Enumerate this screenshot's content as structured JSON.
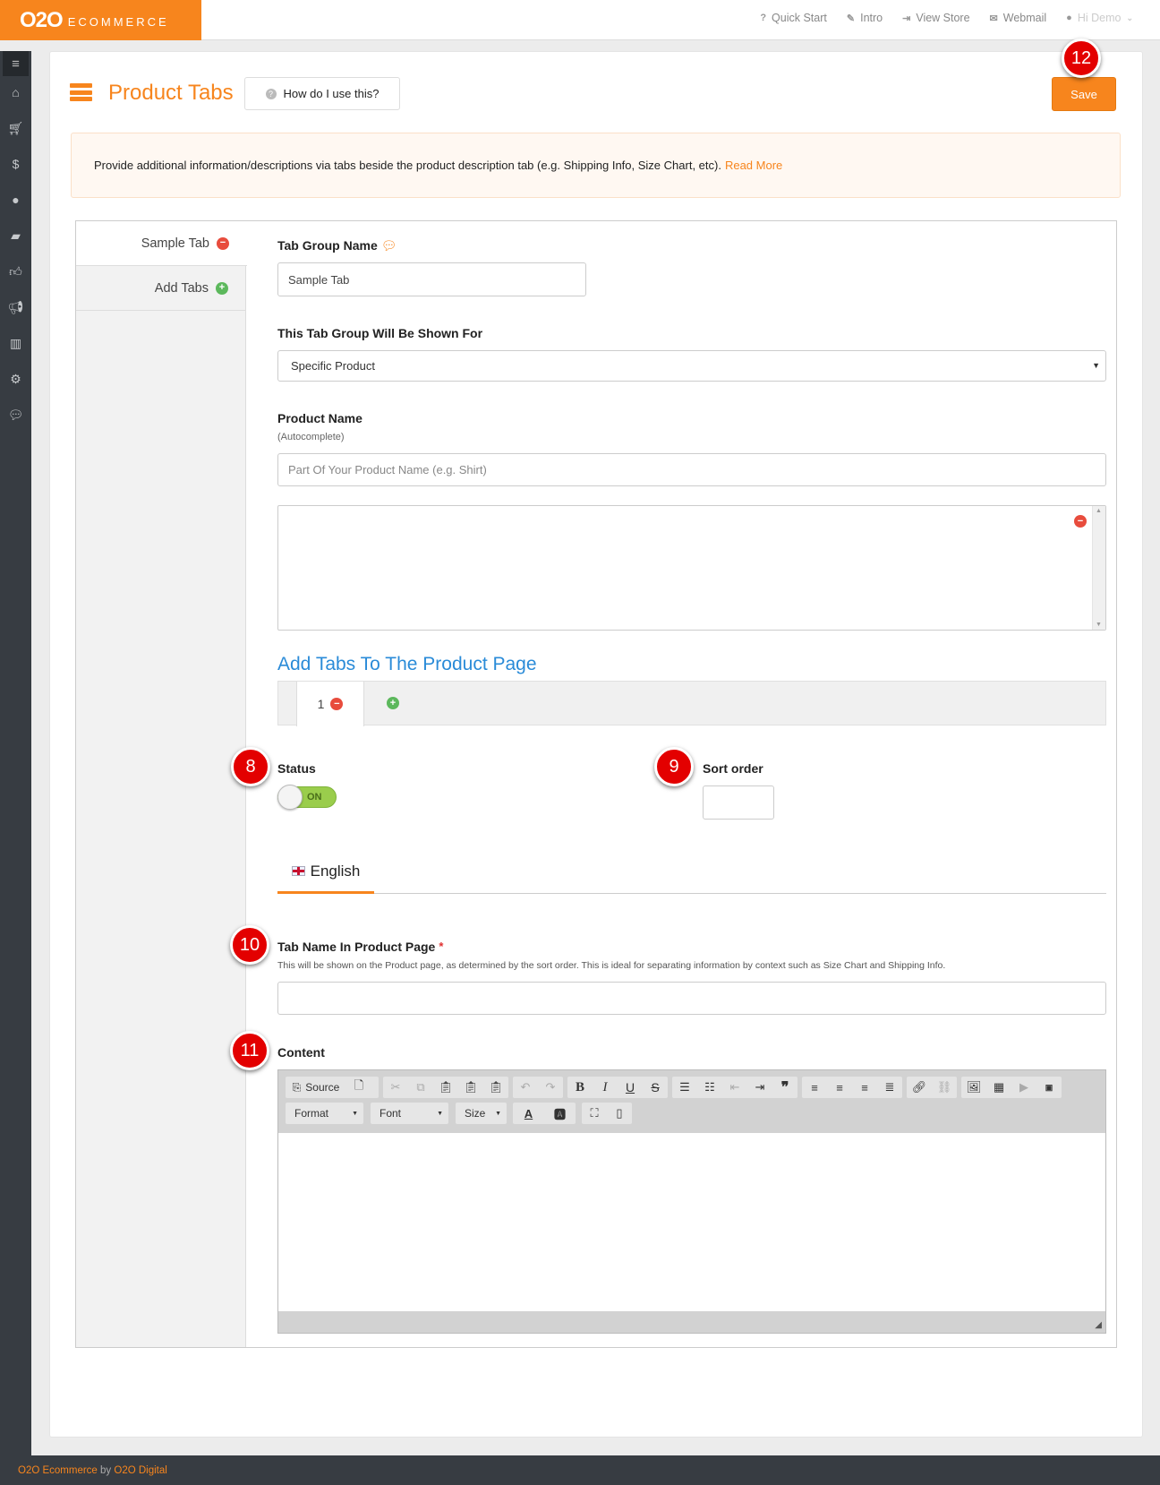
{
  "header": {
    "logo_main": "O2O",
    "logo_sub": "ECOMMERCE",
    "nav": [
      {
        "icon": "question-icon",
        "label": "Quick Start"
      },
      {
        "icon": "wand-icon",
        "label": "Intro"
      },
      {
        "icon": "sign-in-icon",
        "label": "View Store"
      },
      {
        "icon": "envelope-icon",
        "label": "Webmail"
      }
    ],
    "user_label": "Hi Demo"
  },
  "sidebar": {
    "icons": [
      "menu-icon",
      "home-icon",
      "cart-icon",
      "dollar-icon",
      "user-icon",
      "book-icon",
      "thumbs-up-icon",
      "bullhorn-icon",
      "bar-chart-icon",
      "gears-icon",
      "chat-icon"
    ]
  },
  "page": {
    "title": "Product Tabs",
    "help_label": "How do I use this?",
    "save_label": "Save",
    "info_text": "Provide additional information/descriptions via tabs beside the product description tab (e.g. Shipping Info, Size Chart, etc).",
    "info_link": "Read More"
  },
  "vtabs": [
    {
      "label": "Sample Tab"
    },
    {
      "label": "Add Tabs"
    }
  ],
  "form": {
    "group_name_label": "Tab Group Name",
    "group_name_value": "Sample Tab",
    "shown_for_label": "This Tab Group Will Be Shown For",
    "shown_for_value": "Specific Product",
    "product_name_label": "Product Name",
    "product_name_sub": "(Autocomplete)",
    "product_name_placeholder": "Part Of Your Product Name (e.g. Shirt)",
    "add_tabs_title": "Add Tabs To The Product Page",
    "tab_number": "1",
    "status_label": "Status",
    "status_value": "ON",
    "sort_order_label": "Sort order",
    "sort_order_value": "",
    "language": "English",
    "tab_name_label": "Tab Name In Product Page",
    "tab_name_required": "*",
    "tab_name_help": "This will be shown on the Product page, as determined by the sort order. This is ideal for separating information by context such as Size Chart and Shipping Info.",
    "tab_name_value": "",
    "content_label": "Content"
  },
  "editor": {
    "source_label": "Source",
    "format_label": "Format",
    "font_label": "Font",
    "size_label": "Size"
  },
  "badges": [
    "8",
    "9",
    "10",
    "11",
    "12"
  ],
  "footer": {
    "brand": "O2O Ecommerce",
    "by": "by",
    "company": "O2O Digital"
  },
  "colors": {
    "accent": "#f7851d",
    "link_blue": "#2a8bd8",
    "sidebar": "#373c42",
    "badge": "#e30000"
  }
}
